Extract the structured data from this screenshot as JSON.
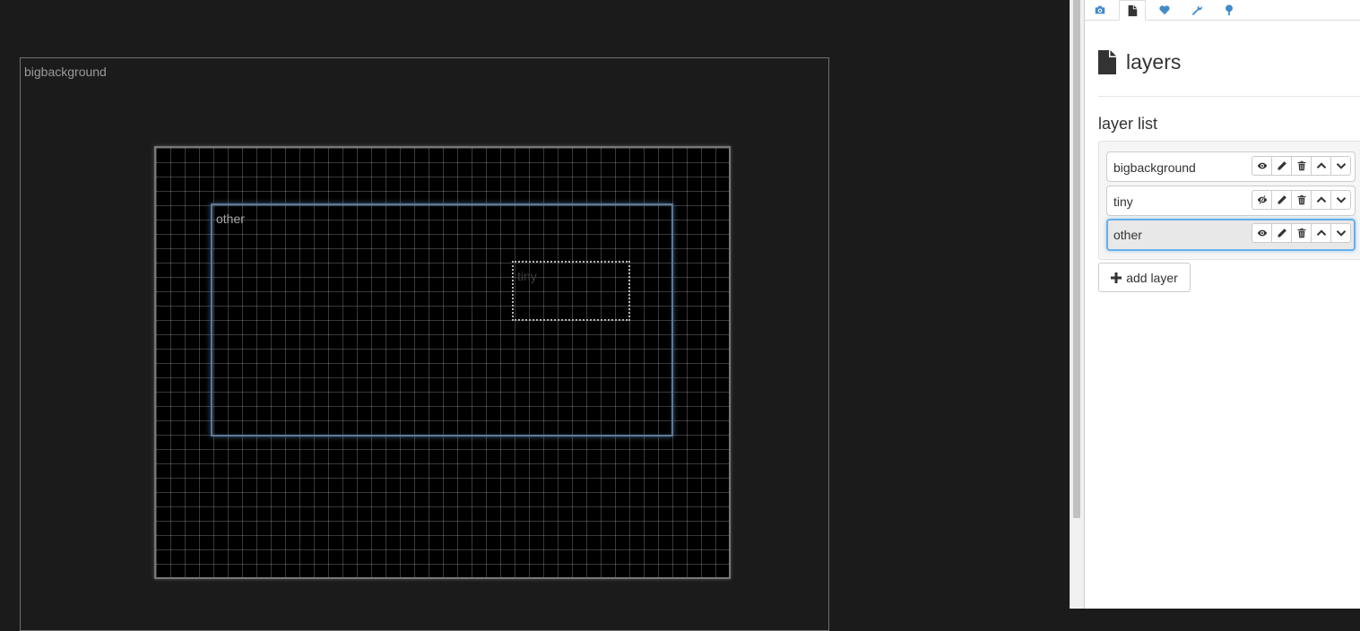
{
  "stage": {
    "layers": {
      "bigbackground": "bigbackground",
      "other": "other",
      "tiny": "tiny"
    }
  },
  "tabs": [
    {
      "icon": "camera-icon"
    },
    {
      "icon": "file-icon",
      "active": true
    },
    {
      "icon": "heart-icon"
    },
    {
      "icon": "wrench-icon"
    },
    {
      "icon": "tree-icon"
    }
  ],
  "panel": {
    "title": "layers",
    "title_icon": "file-icon",
    "list_title": "layer list",
    "layers": [
      {
        "name": "bigbackground",
        "visible": true
      },
      {
        "name": "tiny",
        "visible": false
      },
      {
        "name": "other",
        "visible": true,
        "selected": true
      }
    ],
    "row_buttons": [
      "eye-icon",
      "pencil-icon",
      "trash-icon",
      "chevron-up-icon",
      "chevron-down-icon"
    ],
    "add_layer_label": "add layer"
  },
  "colors": {
    "accent": "#428bca",
    "stage_bg": "#1b1b1b",
    "selected_border": "#66afe9"
  }
}
